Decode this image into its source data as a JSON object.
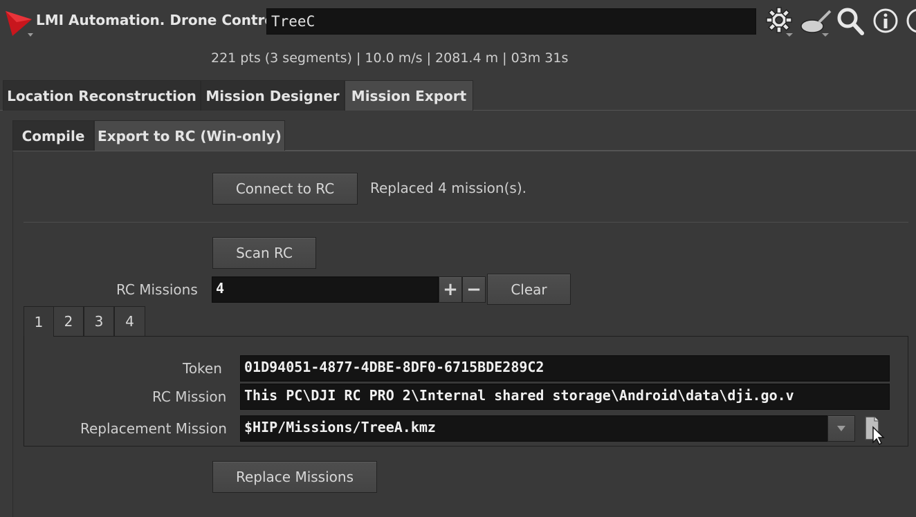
{
  "header": {
    "title": "LMI Automation. Drone Control",
    "node_name": "TreeC",
    "icons": [
      "houdini-logo-icon",
      "gear-icon",
      "wok-icon",
      "search-icon",
      "info-icon",
      "help-icon"
    ]
  },
  "stats": "221 pts (3 segments) | 10.0 m/s | 2081.4 m | 03m 31s",
  "main_tabs": [
    "Location Reconstruction",
    "Mission Designer",
    "Mission Export"
  ],
  "main_tab_active": "Mission Export",
  "sub_tabs": [
    "Compile",
    "Export to RC (Win-only)"
  ],
  "sub_tab_active": "Export to RC (Win-only)",
  "connect": {
    "button": "Connect to RC",
    "status": "Replaced 4 mission(s)."
  },
  "scan": {
    "button": "Scan RC"
  },
  "rc_missions": {
    "label": "RC Missions",
    "value": "4",
    "plus": "+",
    "minus": "−",
    "clear": "Clear"
  },
  "mission_tabs": [
    "1",
    "2",
    "3",
    "4"
  ],
  "mission_tab_active": "1",
  "mission": {
    "token_label": "Token",
    "token_value": "01D94051-4877-4DBE-8DF0-6715BDE289C2",
    "rc_mission_label": "RC Mission",
    "rc_mission_value": "This PC\\DJI RC PRO 2\\Internal shared storage\\Android\\data\\dji.go.v",
    "replacement_label": "Replacement Mission",
    "replacement_value": "$HIP/Missions/TreeA.kmz"
  },
  "replace_button": "Replace Missions",
  "colors": {
    "background": "#3a3a3a",
    "field": "#141414",
    "logo_red": "#c8161d"
  }
}
